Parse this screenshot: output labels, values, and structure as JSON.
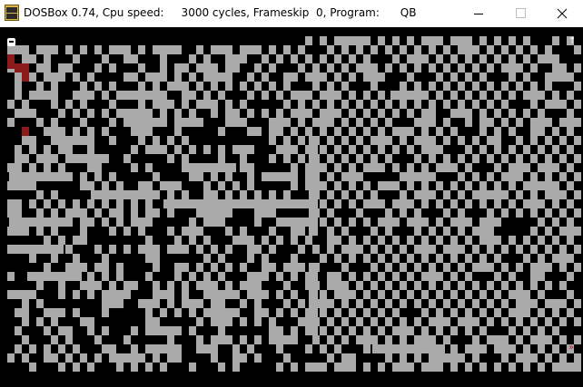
{
  "window": {
    "title": "DOSBox 0.74, Cpu speed:     3000 cycles, Frameskip  0, Program:      QB",
    "controls": [
      "minimize-icon",
      "maximize-icon",
      "close-icon"
    ]
  },
  "game": {
    "wall_color": "#aaaaaa",
    "path_color": "#000000",
    "trail_color": "#8b1a1a",
    "player_icon": "smiley-face-icon",
    "exit_icon": "up-arrow-icon",
    "marker_icon": "red-marker-icon",
    "exit_glyph": "↑",
    "marker_glyph": "»"
  }
}
